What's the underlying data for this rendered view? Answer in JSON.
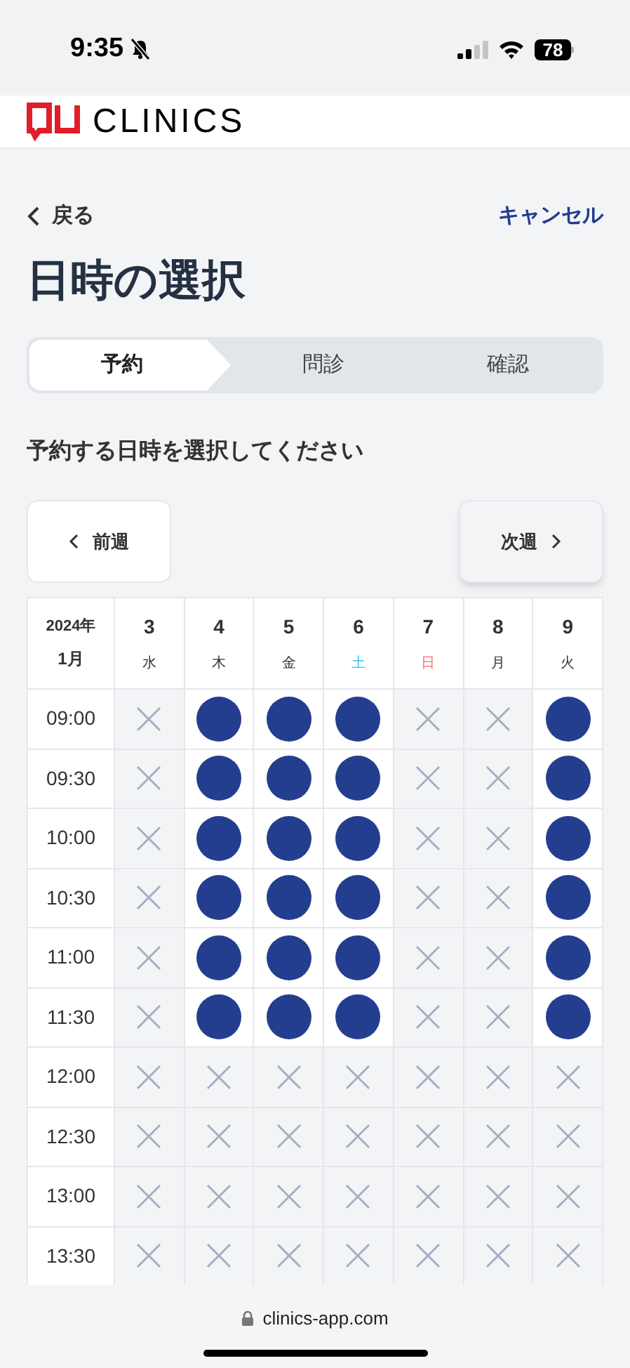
{
  "status_bar": {
    "time": "9:35",
    "battery": "78"
  },
  "header": {
    "logo_text": "CLINICS"
  },
  "nav": {
    "back": "戻る",
    "cancel": "キャンセル"
  },
  "title": "日時の選択",
  "steps": [
    {
      "label": "予約",
      "selected": true
    },
    {
      "label": "問診",
      "selected": false
    },
    {
      "label": "確認",
      "selected": false
    }
  ],
  "prompt": "予約する日時を選択してください",
  "prev_week": "前週",
  "next_week": "次週",
  "calendar": {
    "year": "2024年",
    "month": "1月",
    "days": [
      {
        "date": "3",
        "weekday": "水",
        "color": "#333333"
      },
      {
        "date": "4",
        "weekday": "木",
        "color": "#333333"
      },
      {
        "date": "5",
        "weekday": "金",
        "color": "#333333"
      },
      {
        "date": "6",
        "weekday": "土",
        "color": "#38bdf8"
      },
      {
        "date": "7",
        "weekday": "日",
        "color": "#f87171"
      },
      {
        "date": "8",
        "weekday": "月",
        "color": "#333333"
      },
      {
        "date": "9",
        "weekday": "火",
        "color": "#333333"
      }
    ],
    "rows": [
      {
        "time": "09:00",
        "available": [
          false,
          true,
          true,
          true,
          false,
          false,
          true
        ]
      },
      {
        "time": "09:30",
        "available": [
          false,
          true,
          true,
          true,
          false,
          false,
          true
        ]
      },
      {
        "time": "10:00",
        "available": [
          false,
          true,
          true,
          true,
          false,
          false,
          true
        ]
      },
      {
        "time": "10:30",
        "available": [
          false,
          true,
          true,
          true,
          false,
          false,
          true
        ]
      },
      {
        "time": "11:00",
        "available": [
          false,
          true,
          true,
          true,
          false,
          false,
          true
        ]
      },
      {
        "time": "11:30",
        "available": [
          false,
          true,
          true,
          true,
          false,
          false,
          true
        ]
      },
      {
        "time": "12:00",
        "available": [
          false,
          false,
          false,
          false,
          false,
          false,
          false
        ]
      },
      {
        "time": "12:30",
        "available": [
          false,
          false,
          false,
          false,
          false,
          false,
          false
        ]
      },
      {
        "time": "13:00",
        "available": [
          false,
          false,
          false,
          false,
          false,
          false,
          false
        ]
      },
      {
        "time": "13:30",
        "available": [
          false,
          false,
          false,
          false,
          false,
          false,
          false
        ]
      }
    ]
  },
  "browser": {
    "url": "clinics-app.com"
  }
}
